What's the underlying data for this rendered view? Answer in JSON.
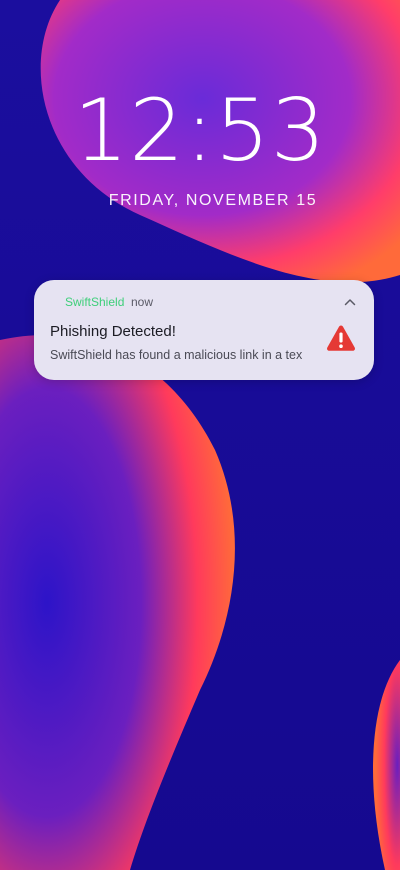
{
  "lockscreen": {
    "time": "12:53",
    "date": "FRIDAY, NOVEMBER 15"
  },
  "notification": {
    "app_name": "SwiftShield",
    "time": "now",
    "title": "Phishing Detected!",
    "body": "SwiftShield has found a malicious link in a tex",
    "app_icon": "shield-icon",
    "status_icon": "warning-icon",
    "collapse_icon": "chevron-up-icon"
  },
  "colors": {
    "background": "#1a0fa3",
    "blob_gradient_start": "#ff5a3c",
    "blob_gradient_end": "#7b2bd6",
    "notification_bg": "#e6e3f2",
    "app_name": "#3ecf7a",
    "warning": "#e53935"
  }
}
